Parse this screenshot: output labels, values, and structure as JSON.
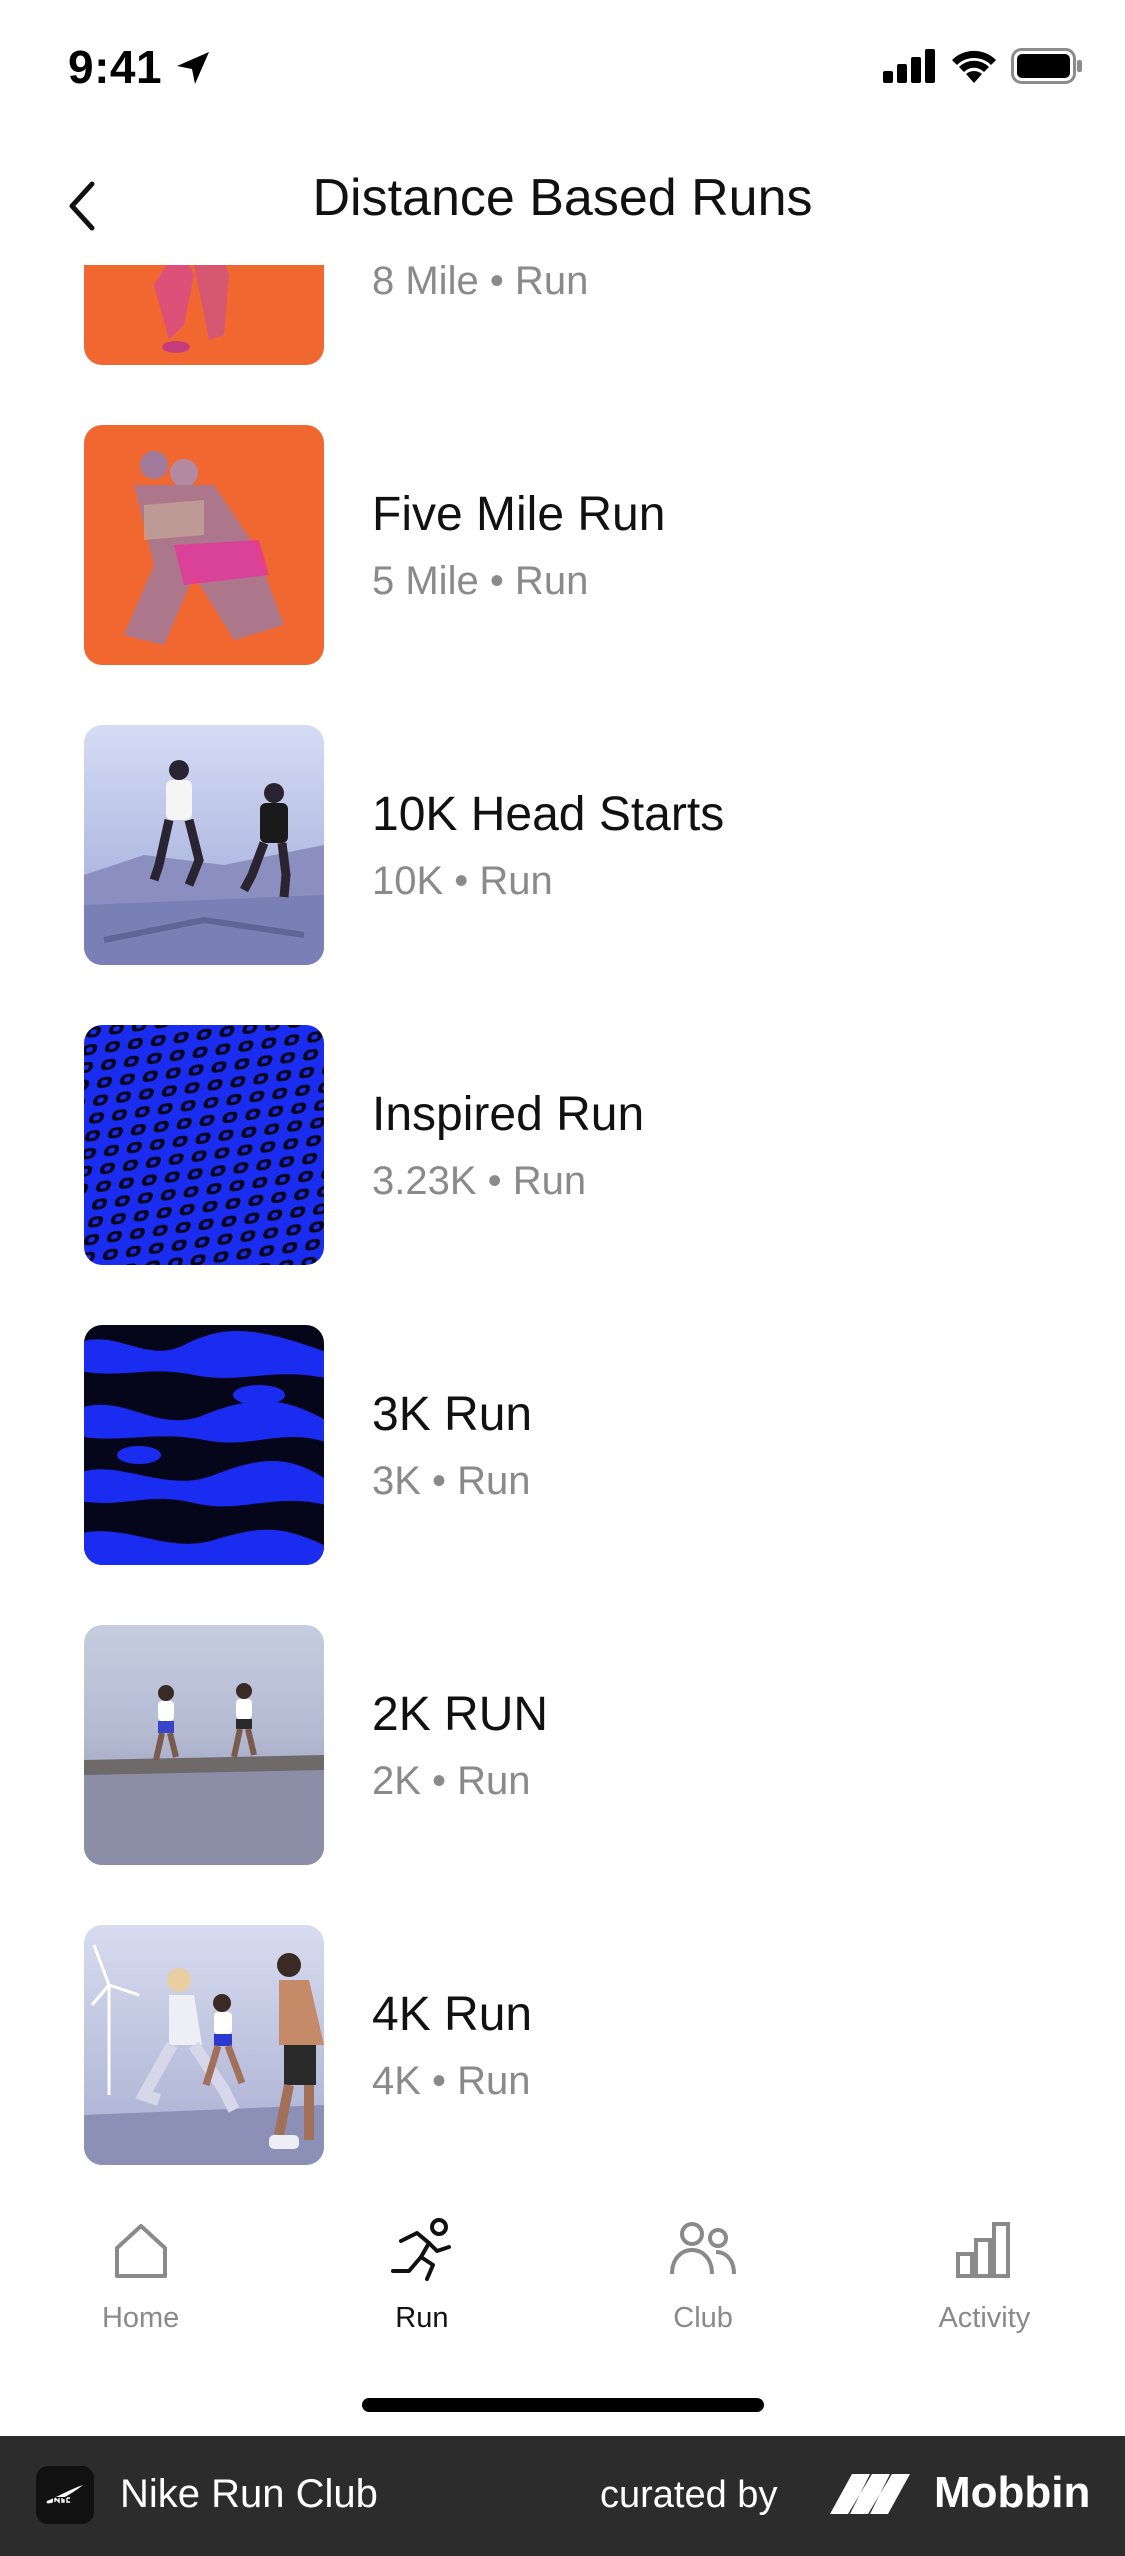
{
  "status": {
    "time": "9:41"
  },
  "header": {
    "title": "Distance Based Runs"
  },
  "runs": [
    {
      "title": "",
      "subtitle": "8 Mile • Run"
    },
    {
      "title": "Five Mile Run",
      "subtitle": "5 Mile • Run"
    },
    {
      "title": "10K Head Starts",
      "subtitle": "10K • Run"
    },
    {
      "title": "Inspired Run",
      "subtitle": "3.23K • Run"
    },
    {
      "title": "3K Run",
      "subtitle": "3K • Run"
    },
    {
      "title": "2K RUN",
      "subtitle": "2K • Run"
    },
    {
      "title": "4K Run",
      "subtitle": "4K • Run"
    }
  ],
  "tabs": [
    {
      "label": "Home",
      "icon": "home-icon",
      "active": false
    },
    {
      "label": "Run",
      "icon": "run-icon",
      "active": true
    },
    {
      "label": "Club",
      "icon": "club-icon",
      "active": false
    },
    {
      "label": "Activity",
      "icon": "activity-icon",
      "active": false
    }
  ],
  "footer": {
    "app_name": "Nike Run Club",
    "curated_by": "curated by",
    "brand": "Mobbin"
  },
  "colors": {
    "orange": "#f0682f",
    "blue": "#1a2cf0",
    "muted_text": "#8a8a8a",
    "footer_bg": "#2c2c2c"
  }
}
